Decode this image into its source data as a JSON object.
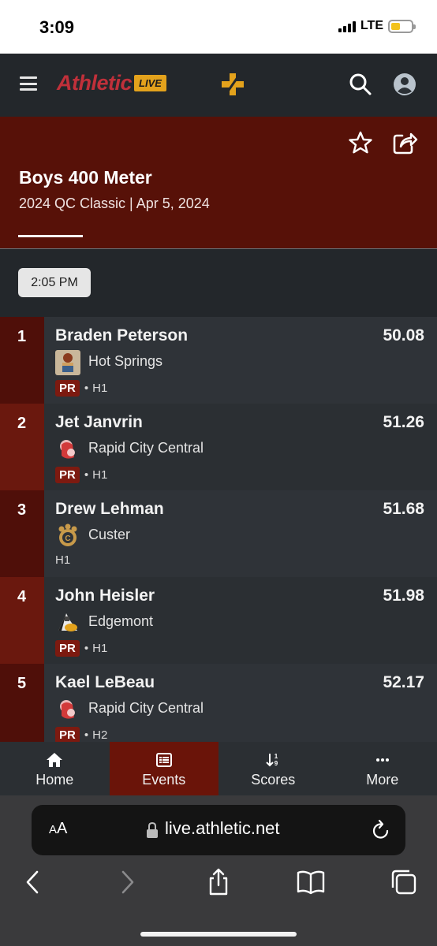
{
  "status_bar": {
    "time": "3:09",
    "network": "LTE",
    "battery_level": 0.35
  },
  "header": {
    "logo_text": "Athletic",
    "logo_badge": "LIVE",
    "brand_red": "#c0303a",
    "brand_gold": "#e3a21c"
  },
  "event": {
    "title": "Boys 400 Meter",
    "subtitle": "2024 QC Classic | Apr 5, 2024",
    "heat_time": "2:05 PM"
  },
  "results": [
    {
      "place": "1",
      "name": "Braden Peterson",
      "mark": "50.08",
      "team": "Hot Springs",
      "pr": "PR",
      "heat": "H1",
      "logo_icon": "hot-springs-logo"
    },
    {
      "place": "2",
      "name": "Jet Janvrin",
      "mark": "51.26",
      "team": "Rapid City Central",
      "pr": "PR",
      "heat": "H1",
      "logo_icon": "rapid-city-central-logo"
    },
    {
      "place": "3",
      "name": "Drew Lehman",
      "mark": "51.68",
      "team": "Custer",
      "pr": "",
      "heat": "H1",
      "logo_icon": "custer-logo"
    },
    {
      "place": "4",
      "name": "John Heisler",
      "mark": "51.98",
      "team": "Edgemont",
      "pr": "PR",
      "heat": "H1",
      "logo_icon": "edgemont-logo"
    },
    {
      "place": "5",
      "name": "Kael LeBeau",
      "mark": "52.17",
      "team": "Rapid City Central",
      "pr": "PR",
      "heat": "H2",
      "logo_icon": "rapid-city-central-logo"
    }
  ],
  "tabs": [
    {
      "label": "Home",
      "icon": "home-icon"
    },
    {
      "label": "Events",
      "icon": "list-icon",
      "active": true
    },
    {
      "label": "Scores",
      "icon": "sort-icon"
    },
    {
      "label": "More",
      "icon": "more-icon"
    }
  ],
  "browser": {
    "text_size_label_small": "A",
    "text_size_label_large": "A",
    "url": "live.athletic.net"
  }
}
